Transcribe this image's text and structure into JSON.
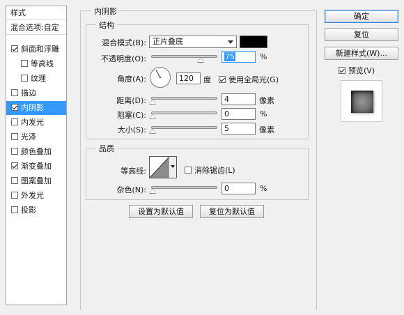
{
  "style_list": {
    "header": "样式",
    "blend_options": "混合选项:自定",
    "items": [
      {
        "label": "斜面和浮雕",
        "checked": true,
        "indent": false,
        "selected": false
      },
      {
        "label": "等高线",
        "checked": false,
        "indent": true,
        "selected": false
      },
      {
        "label": "纹理",
        "checked": false,
        "indent": true,
        "selected": false
      },
      {
        "label": "描边",
        "checked": false,
        "indent": false,
        "selected": false
      },
      {
        "label": "内阴影",
        "checked": true,
        "indent": false,
        "selected": true
      },
      {
        "label": "内发光",
        "checked": false,
        "indent": false,
        "selected": false
      },
      {
        "label": "光泽",
        "checked": false,
        "indent": false,
        "selected": false
      },
      {
        "label": "颜色叠加",
        "checked": false,
        "indent": false,
        "selected": false
      },
      {
        "label": "渐变叠加",
        "checked": true,
        "indent": false,
        "selected": false
      },
      {
        "label": "图案叠加",
        "checked": false,
        "indent": false,
        "selected": false
      },
      {
        "label": "外发光",
        "checked": false,
        "indent": false,
        "selected": false
      },
      {
        "label": "投影",
        "checked": false,
        "indent": false,
        "selected": false
      }
    ]
  },
  "panel": {
    "title": "内阴影",
    "structure": {
      "title": "结构",
      "blend_mode_label": "混合模式(B):",
      "blend_mode_value": "正片叠底",
      "shadow_color": "#000000",
      "opacity_label": "不透明度(O):",
      "opacity_value": "75",
      "opacity_fraction": 0.75,
      "percent": "%",
      "angle_label": "角度(A):",
      "angle_value": "120",
      "angle_unit": "度",
      "global_light_label": "使用全局光(G)",
      "global_light_checked": true,
      "distance_label": "距离(D):",
      "distance_value": "4",
      "px_unit": "像素",
      "choke_label": "阻塞(C):",
      "choke_value": "0",
      "size_label": "大小(S):",
      "size_value": "5"
    },
    "quality": {
      "title": "品质",
      "contour_label": "等高线:",
      "antialias_label": "消除锯齿(L)",
      "antialias_checked": false,
      "noise_label": "杂色(N):",
      "noise_value": "0",
      "percent": "%"
    },
    "set_default_label": "设置为默认值",
    "reset_default_label": "复位为默认值"
  },
  "right": {
    "ok_label": "确定",
    "reset_label": "复位",
    "new_style_label": "新建样式(W)...",
    "preview_label": "预览(V)",
    "preview_checked": true
  }
}
